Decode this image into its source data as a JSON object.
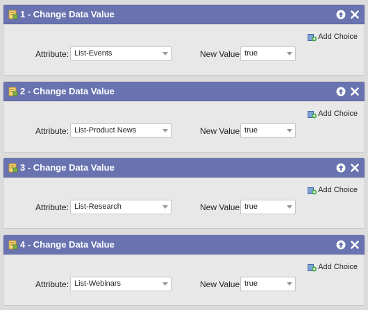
{
  "steps": [
    {
      "title": "1 - Change Data Value",
      "add_choice": "Add Choice",
      "attribute_label": "Attribute:",
      "attribute_value": "List-Events",
      "new_value_label": "New Value:",
      "new_value": "true"
    },
    {
      "title": "2 - Change Data Value",
      "add_choice": "Add Choice",
      "attribute_label": "Attribute:",
      "attribute_value": "List-Product News",
      "new_value_label": "New Value:",
      "new_value": "true"
    },
    {
      "title": "3 - Change Data Value",
      "add_choice": "Add Choice",
      "attribute_label": "Attribute:",
      "attribute_value": "List-Research",
      "new_value_label": "New Value:",
      "new_value": "true"
    },
    {
      "title": "4 - Change Data Value",
      "add_choice": "Add Choice",
      "attribute_label": "Attribute:",
      "attribute_value": "List-Webinars",
      "new_value_label": "New Value:",
      "new_value": "true"
    }
  ],
  "icons": {
    "step": "flow-step-icon",
    "move_up": "arrow-up-icon",
    "remove": "close-icon",
    "add_choice": "add-choice-icon",
    "dropdown": "chevron-down-icon"
  },
  "colors": {
    "header_bg": "#6873b0",
    "panel_bg": "#e8e8e8",
    "page_bg": "#dcdcdc"
  }
}
